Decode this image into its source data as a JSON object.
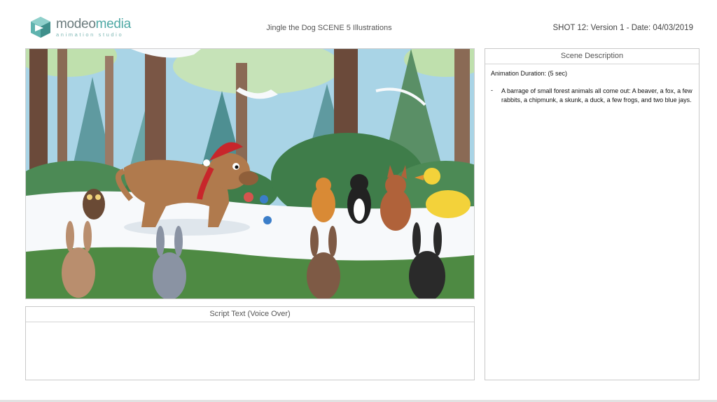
{
  "header": {
    "logo": {
      "brand_part1": "modeo",
      "brand_part2": "media",
      "tagline": "animation studio",
      "icon": "modeo-cube-logo"
    },
    "title": "Jingle the Dog SCENE 5 Illustrations",
    "shot_info": "SHOT 12: Version 1  - Date: 04/03/2019"
  },
  "scene_panel": {
    "illustration": "storyboard-frame-forest-animals"
  },
  "script_panel": {
    "heading": "Script Text (Voice Over)",
    "body": ""
  },
  "description_panel": {
    "heading": "Scene Description",
    "duration": "Animation Duration: (5 sec)",
    "bullet_marker": "-",
    "bullet": "A barrage of small forest animals all come out:  A beaver, a fox, a few rabbits, a chipmunk, a skunk, a duck, a few frogs, and two blue jays."
  },
  "colors": {
    "brand_teal": "#4fa9a5",
    "brand_gray": "#6b7b7d",
    "sky": "#a9d4e6",
    "forest_green": "#4c8a55",
    "snow": "#f7f9fb"
  }
}
